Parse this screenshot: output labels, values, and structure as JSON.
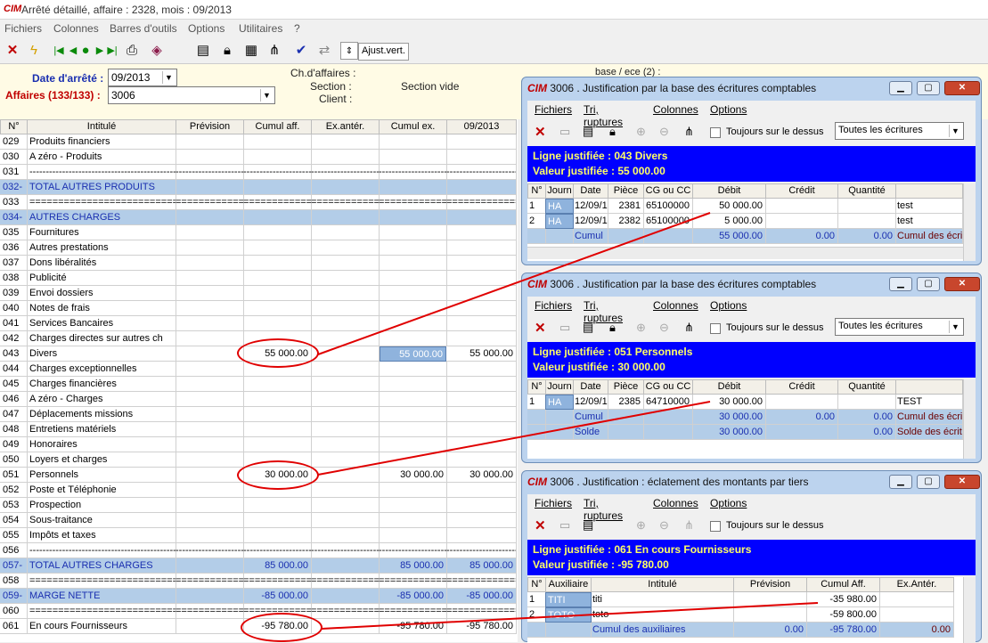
{
  "window": {
    "logo": "CIM",
    "title": "Arrêté détaillé, affaire : 2328, mois : 09/2013"
  },
  "menu": [
    "Fichiers",
    "Colonnes",
    "Barres d'outils",
    "Options",
    "Utilitaires",
    "?"
  ],
  "toolbar": {
    "ajust_label": "Ajust.vert.",
    "icons": [
      "close-icon",
      "lightning-icon",
      "first-icon",
      "prev-icon",
      "stop-icon",
      "next-icon",
      "last-icon",
      "print-icon",
      "book-icon",
      "columns-icon",
      "lock-icon",
      "grid-icon",
      "tree-icon",
      "check-icon",
      "arrows-icon",
      "stepper-icon"
    ]
  },
  "header": {
    "date_label": "Date d'arrêté :",
    "date_value": "09/2013",
    "affaires_label": "Affaires (133/133) :",
    "affaires_value": "3006",
    "ch_affaires_label": "Ch.d'affaires :",
    "section_label": "Section :",
    "section_value": "Section vide",
    "client_label": "Client :",
    "overflow_text": "base / ece (2) :"
  },
  "grid": {
    "columns": [
      "N°",
      "Intitulé",
      "Prévision",
      "Cumul aff.",
      "Ex.antér.",
      "Cumul ex.",
      "09/2013"
    ],
    "rows": [
      {
        "n": "029",
        "label": "Produits financiers",
        "prev": "",
        "cumul": "",
        "ex": "",
        "cumulex": "",
        "m": ""
      },
      {
        "n": "030",
        "label": "A zéro - Produits",
        "prev": "",
        "cumul": "",
        "ex": "",
        "cumulex": "",
        "m": ""
      },
      {
        "n": "031",
        "label": "---------------------------------------------",
        "prev": "----------------------",
        "cumul": "----------------------",
        "ex": "----------------------",
        "cumulex": "----------------------",
        "m": "----------------------"
      },
      {
        "n": "032-",
        "label": "TOTAL AUTRES PRODUITS",
        "prev": "",
        "cumul": "",
        "ex": "",
        "cumulex": "",
        "m": "",
        "total": true
      },
      {
        "n": "033",
        "label": "=========================================",
        "prev": "=============",
        "cumul": "=============",
        "ex": "=============",
        "cumulex": "=============",
        "m": "============="
      },
      {
        "n": "034-",
        "label": "AUTRES CHARGES",
        "prev": "",
        "cumul": "",
        "ex": "",
        "cumulex": "",
        "m": "",
        "total": true
      },
      {
        "n": "035",
        "label": "Fournitures",
        "prev": "",
        "cumul": "",
        "ex": "",
        "cumulex": "",
        "m": ""
      },
      {
        "n": "036",
        "label": "Autres prestations",
        "prev": "",
        "cumul": "",
        "ex": "",
        "cumulex": "",
        "m": ""
      },
      {
        "n": "037",
        "label": "Dons libéralités",
        "prev": "",
        "cumul": "",
        "ex": "",
        "cumulex": "",
        "m": ""
      },
      {
        "n": "038",
        "label": "Publicité",
        "prev": "",
        "cumul": "",
        "ex": "",
        "cumulex": "",
        "m": ""
      },
      {
        "n": "039",
        "label": "Envoi dossiers",
        "prev": "",
        "cumul": "",
        "ex": "",
        "cumulex": "",
        "m": ""
      },
      {
        "n": "040",
        "label": "Notes de frais",
        "prev": "",
        "cumul": "",
        "ex": "",
        "cumulex": "",
        "m": ""
      },
      {
        "n": "041",
        "label": "Services Bancaires",
        "prev": "",
        "cumul": "",
        "ex": "",
        "cumulex": "",
        "m": ""
      },
      {
        "n": "042",
        "label": "Charges directes sur autres ch",
        "prev": "",
        "cumul": "",
        "ex": "",
        "cumulex": "",
        "m": ""
      },
      {
        "n": "043",
        "label": "Divers",
        "prev": "",
        "cumul": "55 000.00",
        "ex": "",
        "cumulex": "55 000.00",
        "m": "55 000.00",
        "hl": true
      },
      {
        "n": "044",
        "label": "Charges exceptionnelles",
        "prev": "",
        "cumul": "",
        "ex": "",
        "cumulex": "",
        "m": ""
      },
      {
        "n": "045",
        "label": "Charges financières",
        "prev": "",
        "cumul": "",
        "ex": "",
        "cumulex": "",
        "m": ""
      },
      {
        "n": "046",
        "label": "A zéro - Charges",
        "prev": "",
        "cumul": "",
        "ex": "",
        "cumulex": "",
        "m": ""
      },
      {
        "n": "047",
        "label": "Déplacements missions",
        "prev": "",
        "cumul": "",
        "ex": "",
        "cumulex": "",
        "m": ""
      },
      {
        "n": "048",
        "label": "Entretiens matériels",
        "prev": "",
        "cumul": "",
        "ex": "",
        "cumulex": "",
        "m": ""
      },
      {
        "n": "049",
        "label": "Honoraires",
        "prev": "",
        "cumul": "",
        "ex": "",
        "cumulex": "",
        "m": ""
      },
      {
        "n": "050",
        "label": "Loyers et charges",
        "prev": "",
        "cumul": "",
        "ex": "",
        "cumulex": "",
        "m": ""
      },
      {
        "n": "051",
        "label": "Personnels",
        "prev": "",
        "cumul": "30 000.00",
        "ex": "",
        "cumulex": "30 000.00",
        "m": "30 000.00"
      },
      {
        "n": "052",
        "label": "Poste et Téléphonie",
        "prev": "",
        "cumul": "",
        "ex": "",
        "cumulex": "",
        "m": ""
      },
      {
        "n": "053",
        "label": "Prospection",
        "prev": "",
        "cumul": "",
        "ex": "",
        "cumulex": "",
        "m": ""
      },
      {
        "n": "054",
        "label": "Sous-traitance",
        "prev": "",
        "cumul": "",
        "ex": "",
        "cumulex": "",
        "m": ""
      },
      {
        "n": "055",
        "label": "Impôts et taxes",
        "prev": "",
        "cumul": "",
        "ex": "",
        "cumulex": "",
        "m": ""
      },
      {
        "n": "056",
        "label": "---------------------------------------------",
        "prev": "----------------------",
        "cumul": "----------------------",
        "ex": "----------------------",
        "cumulex": "----------------------",
        "m": "----------------------"
      },
      {
        "n": "057-",
        "label": "TOTAL AUTRES CHARGES",
        "prev": "",
        "cumul": "85 000.00",
        "ex": "",
        "cumulex": "85 000.00",
        "m": "85 000.00",
        "total": true
      },
      {
        "n": "058",
        "label": "=========================================",
        "prev": "=============",
        "cumul": "=============",
        "ex": "=============",
        "cumulex": "=============",
        "m": "============="
      },
      {
        "n": "059-",
        "label": "MARGE NETTE",
        "prev": "",
        "cumul": "-85 000.00",
        "ex": "",
        "cumulex": "-85 000.00",
        "m": "-85 000.00",
        "total": true
      },
      {
        "n": "060",
        "label": "=========================================",
        "prev": "=============",
        "cumul": "=============",
        "ex": "=============",
        "cumulex": "=============",
        "m": "============="
      },
      {
        "n": "061",
        "label": "En cours Fournisseurs",
        "prev": "",
        "cumul": "-95 780.00",
        "ex": "",
        "cumulex": "-95 780.00",
        "m": "-95 780.00"
      }
    ]
  },
  "win1": {
    "logo": "CIM",
    "title": "3006 . Justification par la base des écritures comptables",
    "menu": [
      "Fichiers",
      "Tri, ruptures",
      "Colonnes",
      "Options"
    ],
    "check_label": "Toujours sur le dessus",
    "combo": "Toutes les écritures",
    "ligne": "Ligne justifiée :  043 Divers",
    "valeur": "Valeur justifiée :  55 000.00",
    "columns": [
      "N°",
      "Journ",
      "Date",
      "Pièce",
      "CG ou CC",
      "Débit",
      "Crédit",
      "Quantité",
      ""
    ],
    "rows": [
      [
        "1",
        "HA",
        "12/09/1",
        "2381",
        "65100000",
        "50 000.00",
        "",
        "",
        "test"
      ],
      [
        "2",
        "HA",
        "12/09/1",
        "2382",
        "65100000",
        "5 000.00",
        "",
        "",
        "test"
      ]
    ],
    "total": [
      "",
      "",
      "Cumul",
      "",
      "",
      "55 000.00",
      "0.00",
      "0.00",
      "Cumul des écri"
    ]
  },
  "win2": {
    "logo": "CIM",
    "title": "3006 . Justification par la base des écritures comptables",
    "menu": [
      "Fichiers",
      "Tri, ruptures",
      "Colonnes",
      "Options"
    ],
    "check_label": "Toujours sur le dessus",
    "combo": "Toutes les écritures",
    "ligne": "Ligne justifiée :  051 Personnels",
    "valeur": "Valeur justifiée :  30 000.00",
    "columns": [
      "N°",
      "Journ",
      "Date",
      "Pièce",
      "CG ou CC",
      "Débit",
      "Crédit",
      "Quantité",
      ""
    ],
    "rows": [
      [
        "1",
        "HA",
        "12/09/1",
        "2385",
        "64710000",
        "30 000.00",
        "",
        "",
        "TEST"
      ]
    ],
    "totals": [
      [
        "",
        "",
        "Cumul",
        "",
        "",
        "30 000.00",
        "0.00",
        "0.00",
        "Cumul des écri"
      ],
      [
        "",
        "",
        "Solde",
        "",
        "",
        "30 000.00",
        "",
        "0.00",
        "Solde des écrit"
      ]
    ]
  },
  "win3": {
    "logo": "CIM",
    "title": "3006 . Justification : éclatement des montants par tiers",
    "menu": [
      "Fichiers",
      "Tri, ruptures",
      "Colonnes",
      "Options"
    ],
    "check_label": "Toujours sur le dessus",
    "ligne": "Ligne justifiée :  061 En cours Fournisseurs",
    "valeur": "Valeur justifiée :  -95 780.00",
    "columns": [
      "N°",
      "Auxiliaire",
      "Intitulé",
      "Prévision",
      "Cumul Aff.",
      "Ex.Antér."
    ],
    "rows": [
      [
        "1",
        "TITI",
        "titi",
        "",
        "-35 980.00",
        ""
      ],
      [
        "2",
        "TOTO",
        "toto",
        "",
        "-59 800.00",
        ""
      ]
    ],
    "total": [
      "",
      "",
      "Cumul des auxiliaires",
      "0.00",
      "-95 780.00",
      "0.00"
    ]
  }
}
